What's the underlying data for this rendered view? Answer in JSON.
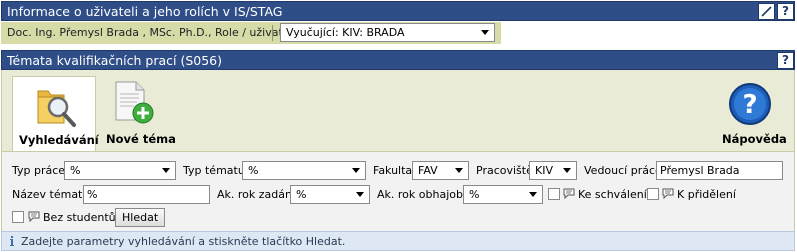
{
  "user_bar": {
    "title": "Informace o uživateli a jeho rolích v IS/STAG",
    "edit_icon": "pencil-icon",
    "help_label": "?"
  },
  "user_info": {
    "name_role": "Doc. Ing. Přemysl Brada , MSc. Ph.D., Role / uživatel",
    "role_select": "Vyučující: KIV: BRADA"
  },
  "section_bar": {
    "title": "Témata kvalifikačních prací (S056)",
    "help_label": "?"
  },
  "toolbar": {
    "search_label": "Vyhledávání",
    "new_topic_label": "Nové téma",
    "help_label": "Nápověda",
    "help_glyph": "?"
  },
  "form": {
    "typ_prace_label": "Typ práce",
    "typ_prace_value": "%",
    "typ_tematu_label": "Typ tématu",
    "typ_tematu_value": "%",
    "fakulta_label": "Fakulta",
    "fakulta_value": "FAV",
    "pracoviste_label": "Pracoviště",
    "pracoviste_value": "KIV",
    "vedouci_label": "Vedoucí práce",
    "vedouci_value": "Přemysl Brada",
    "nazev_label": "Název tématu",
    "nazev_value": "%",
    "rok_zadani_label": "Ak. rok zadání",
    "rok_zadani_value": "%",
    "rok_obhajoby_label": "Ak. rok obhajoby",
    "rok_obhajoby_value": "%",
    "ke_schvaleni_label": "Ke schválení",
    "k_prideleni_label": "K přidělení",
    "bez_studentu_label": "Bez studentů",
    "hledat_label": "Hledat"
  },
  "info": {
    "message": "Zadejte parametry vyhledávání a stiskněte tlačítko Hledat."
  }
}
